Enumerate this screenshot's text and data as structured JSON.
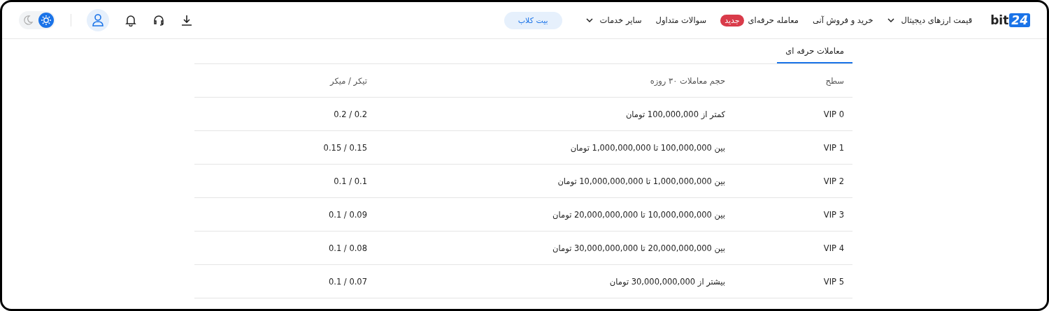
{
  "header": {
    "logo": {
      "text": "bit",
      "badge": "24"
    },
    "nav": [
      {
        "label": "قیمت ارزهای دیجیتال",
        "dropdown": true
      },
      {
        "label": "خرید و فروش آنی",
        "dropdown": false
      },
      {
        "label": "معامله حرفه‌ای",
        "dropdown": false,
        "badge": "جدید"
      },
      {
        "label": "سوالات متداول",
        "dropdown": false
      },
      {
        "label": "سایر خدمات",
        "dropdown": true
      }
    ],
    "club_button": "بیت کلاب",
    "theme_toggle": [
      {
        "kind": "sun",
        "selected": true
      },
      {
        "kind": "moon",
        "selected": false
      }
    ]
  },
  "tabs": [
    {
      "label": "معاملات حرفه ای",
      "selected": true
    }
  ],
  "table": {
    "columns": [
      "سطح",
      "حجم معاملات ۳۰ روزه",
      "تیکر / میکر"
    ],
    "rows": [
      [
        "VIP 0",
        "کمتر از 100,000,000 تومان",
        "0.2 / 0.2"
      ],
      [
        "VIP 1",
        "بین 100,000,000 تا 1,000,000,000 تومان",
        "0.15 / 0.15"
      ],
      [
        "VIP 2",
        "بین 1,000,000,000 تا 10,000,000,000 تومان",
        "0.1 / 0.1"
      ],
      [
        "VIP 3",
        "بین 10,000,000,000 تا 20,000,000,000 تومان",
        "0.09 / 0.1"
      ],
      [
        "VIP 4",
        "بین 20,000,000,000 تا 30,000,000,000 تومان",
        "0.08 / 0.1"
      ],
      [
        "VIP 5",
        "بیشتر از 30,000,000,000 تومان",
        "0.07 / 0.1"
      ]
    ]
  }
}
